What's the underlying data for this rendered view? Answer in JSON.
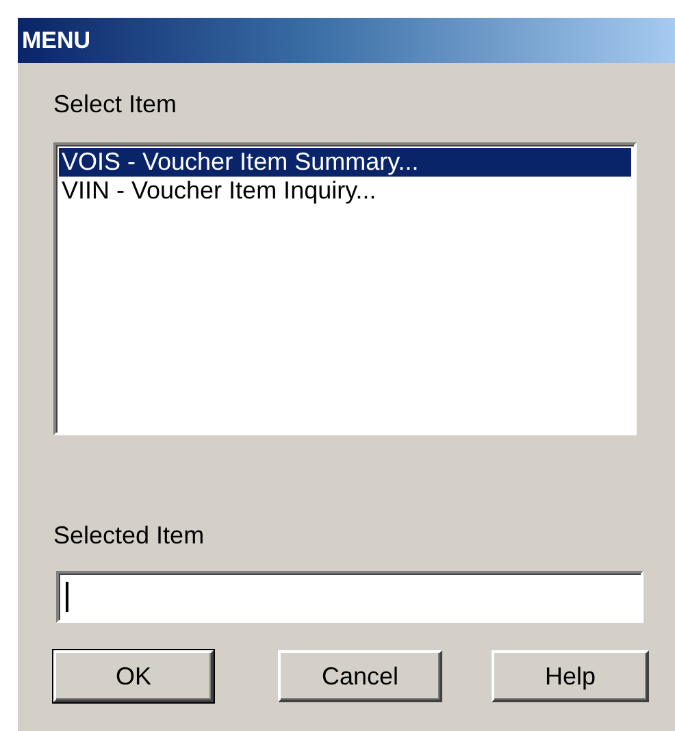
{
  "window": {
    "title": "MENU"
  },
  "list_label": "Select Item",
  "items": [
    {
      "label": "VOIS - Voucher Item Summary...",
      "selected": true
    },
    {
      "label": "VIIN - Voucher Item Inquiry...",
      "selected": false
    }
  ],
  "field": {
    "label": "Selected Item",
    "focused": true
  },
  "buttons": [
    {
      "label": "OK",
      "default": true
    },
    {
      "label": "Cancel",
      "default": false
    },
    {
      "label": "Help",
      "default": false
    }
  ]
}
